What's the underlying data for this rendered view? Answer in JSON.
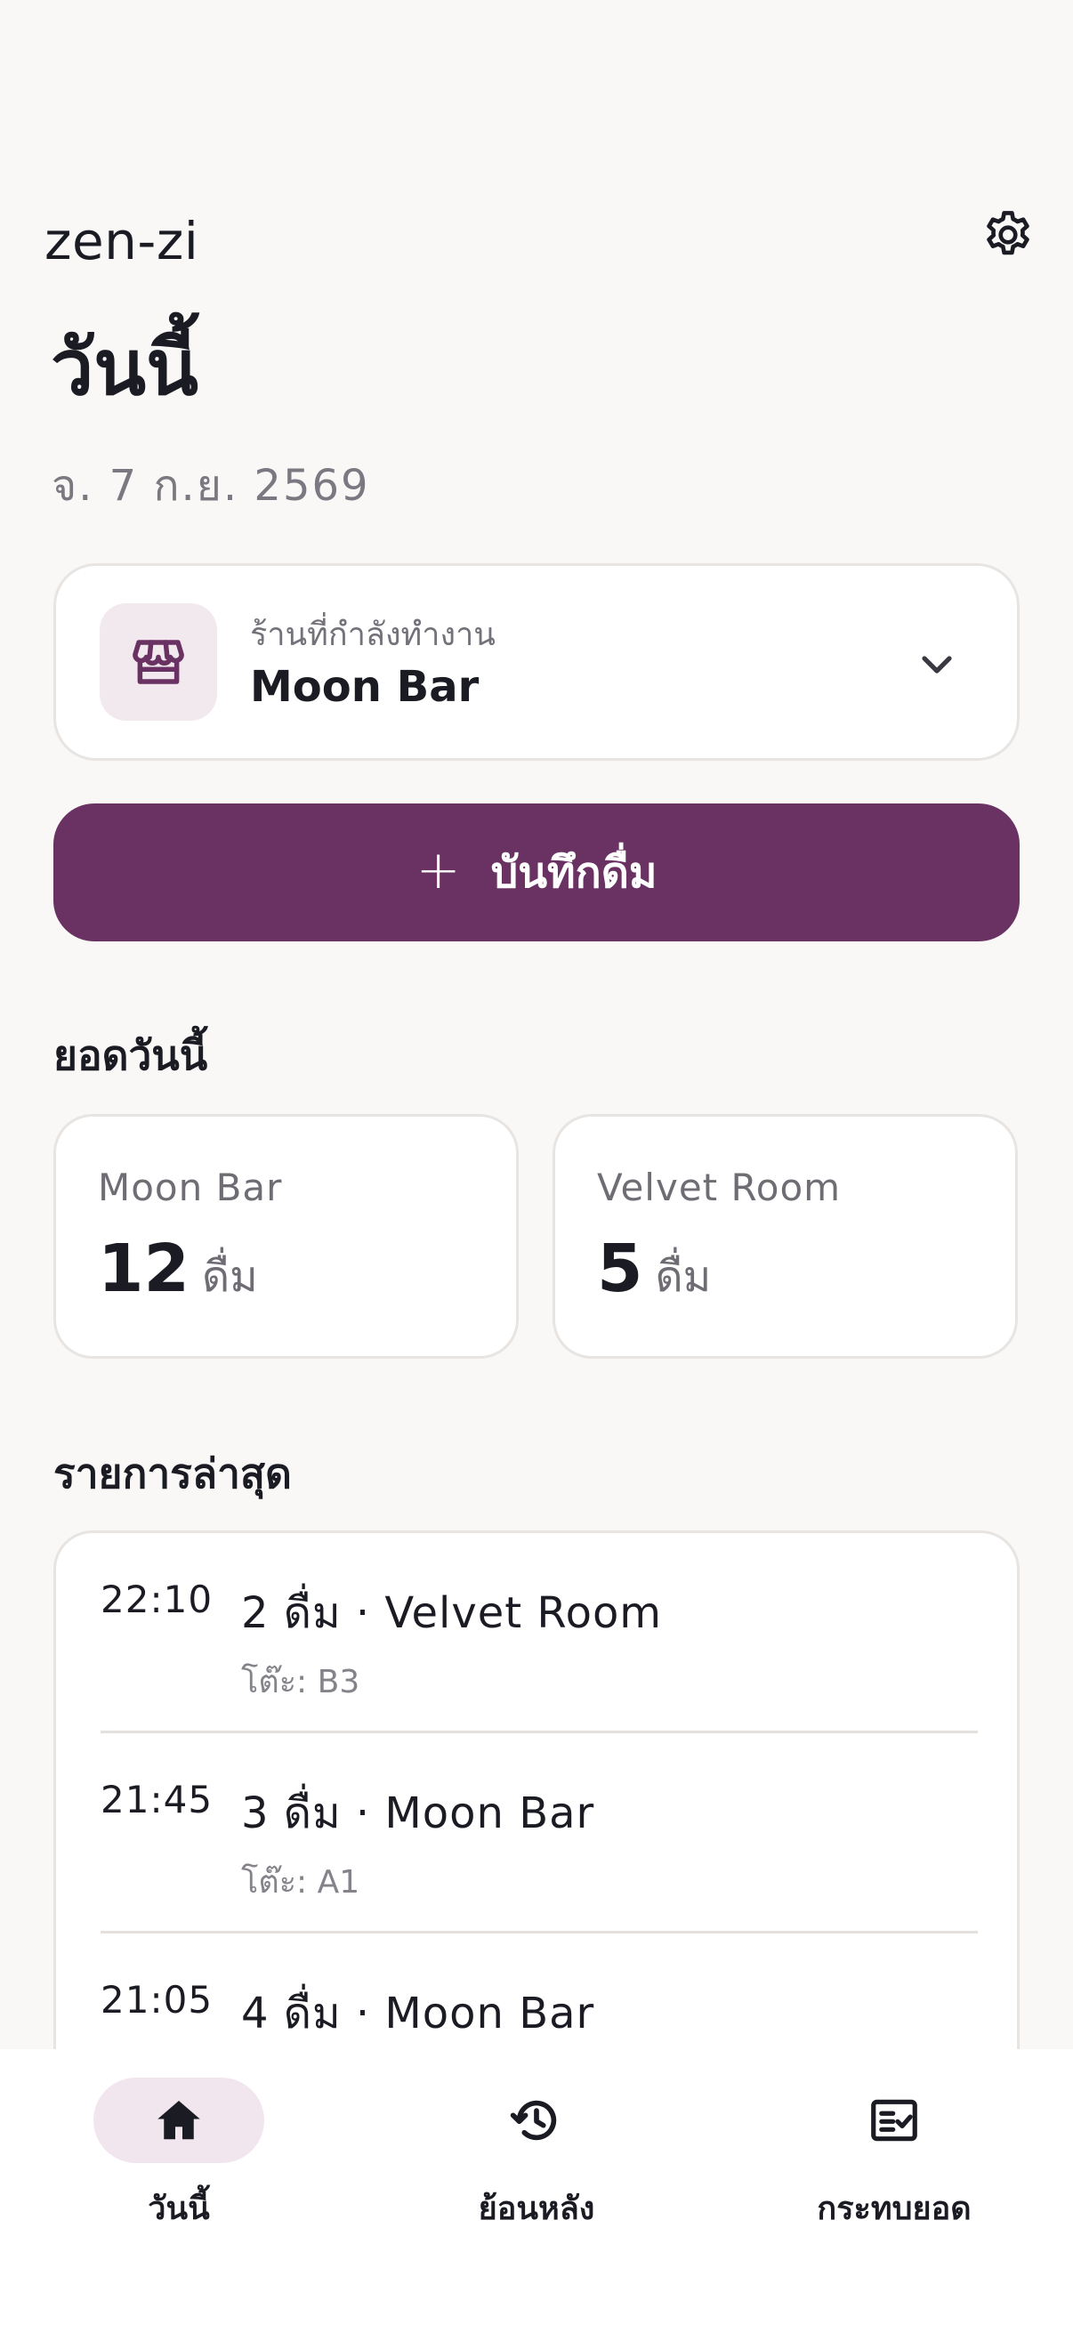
{
  "app": {
    "name": "zen-zi"
  },
  "page": {
    "title": "วันนี้",
    "date": "จ. 7 ก.ย. 2569"
  },
  "shop_selector": {
    "caption": "ร้านที่กำลังทำงาน",
    "name": "Moon Bar",
    "icon": "store-icon"
  },
  "record_button": {
    "label": "บันทึกดื่ม",
    "icon": "plus-icon"
  },
  "today_totals": {
    "title": "ยอดวันนี้",
    "cards": [
      {
        "shop": "Moon Bar",
        "count": "12",
        "unit": "ดื่ม"
      },
      {
        "shop": "Velvet Room",
        "count": "5",
        "unit": "ดื่ม"
      }
    ]
  },
  "recent": {
    "title": "รายการล่าสุด",
    "items": [
      {
        "time": "22:10",
        "summary": "2 ดื่ม · Velvet Room",
        "detail": "โต๊ะ: B3"
      },
      {
        "time": "21:45",
        "summary": "3 ดื่ม · Moon Bar",
        "detail": "โต๊ะ: A1"
      },
      {
        "time": "21:05",
        "summary": "4 ดื่ม · Moon Bar",
        "detail": ""
      }
    ]
  },
  "nav": {
    "items": [
      {
        "label": "วันนี้",
        "icon": "home-icon",
        "active": true
      },
      {
        "label": "ย้อนหลัง",
        "icon": "history-icon",
        "active": false
      },
      {
        "label": "กระทบยอด",
        "icon": "checklist-icon",
        "active": false
      }
    ]
  },
  "colors": {
    "primary": "#6A3262",
    "background": "#F9F8F6",
    "card": "#FFFFFF",
    "text": "#1B1B24",
    "muted": "#7A7880",
    "active_pill": "#F1E6EE"
  }
}
